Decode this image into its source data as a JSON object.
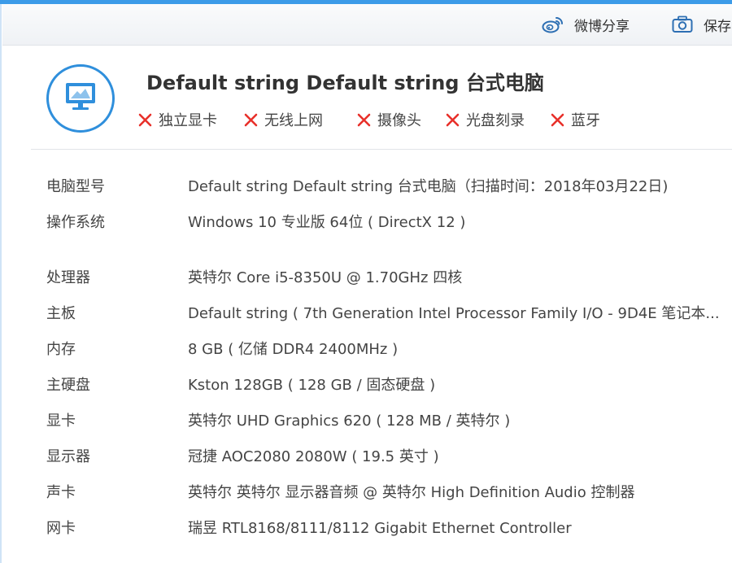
{
  "toolbar": {
    "weibo_label": "微博分享",
    "save_label": "保存",
    "accent_color": "#3c9be8"
  },
  "header": {
    "title": "Default string Default string 台式电脑",
    "icon": "monitor-icon",
    "icon_color": "#2f8fdc",
    "features": [
      {
        "label": "独立显卡",
        "status": "missing"
      },
      {
        "label": "无线上网",
        "status": "missing"
      },
      {
        "label": "摄像头",
        "status": "missing"
      },
      {
        "label": "光盘刻录",
        "status": "missing"
      },
      {
        "label": "蓝牙",
        "status": "missing"
      }
    ],
    "missing_color": "#e8302a"
  },
  "specs": [
    {
      "label": "电脑型号",
      "value": "Default string Default string 台式电脑（扫描时间：2018年03月22日)"
    },
    {
      "label": "操作系统",
      "value": "Windows 10 专业版 64位 ( DirectX 12 )"
    },
    {
      "label": "处理器",
      "value": "英特尔 Core i5-8350U @ 1.70GHz 四核"
    },
    {
      "label": "主板",
      "value": "Default string ( 7th Generation Intel Processor Family I/O - 9D4E 笔记本..."
    },
    {
      "label": "内存",
      "value": "8 GB ( 亿储 DDR4 2400MHz )"
    },
    {
      "label": "主硬盘",
      "value": " Kston 128GB ( 128 GB / 固态硬盘 )"
    },
    {
      "label": "显卡",
      "value": "英特尔 UHD Graphics 620 ( 128 MB / 英特尔 )"
    },
    {
      "label": "显示器",
      "value": "冠捷 AOC2080 2080W ( 19.5 英寸 )"
    },
    {
      "label": "声卡",
      "value": "英特尔 英特尔 显示器音频 @ 英特尔 High Definition Audio 控制器"
    },
    {
      "label": "网卡",
      "value": "瑞昱 RTL8168/8111/8112 Gigabit Ethernet Controller"
    }
  ]
}
